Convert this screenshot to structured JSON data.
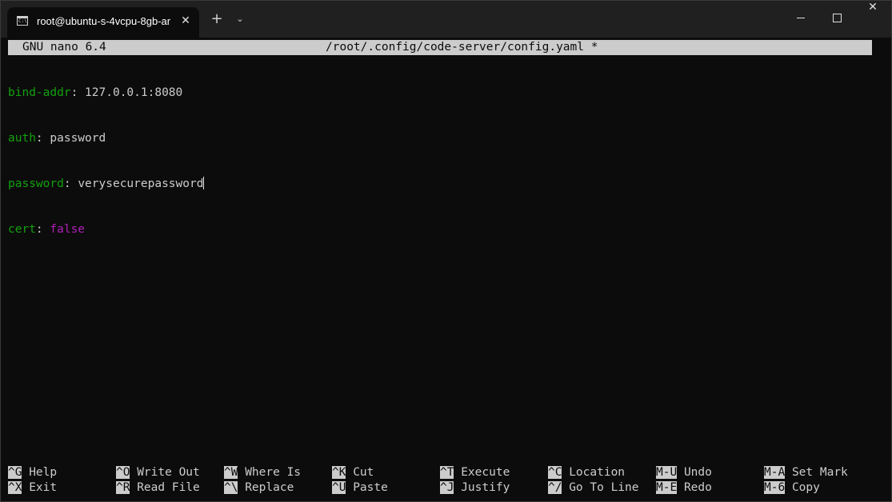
{
  "window": {
    "tab_title": "root@ubuntu-s-4vcpu-8gb-ar",
    "tab_icon_text": "C:\\",
    "new_tab": "+",
    "tab_dropdown": "⌄",
    "close_tab": "✕",
    "close_window": "✕"
  },
  "nano": {
    "version": "GNU nano 6.4",
    "file_path": "/root/.config/code-server/config.yaml *"
  },
  "file_lines": [
    {
      "key": "bind-addr",
      "sep": ": ",
      "value": "127.0.0.1:8080"
    },
    {
      "key": "auth",
      "sep": ": ",
      "value": "password"
    },
    {
      "key": "password",
      "sep": ": ",
      "value": "verysecurepassword"
    },
    {
      "key": "cert",
      "sep": ": ",
      "value": "false"
    }
  ],
  "shortcuts": [
    [
      {
        "key": "^G",
        "label": "Help"
      },
      {
        "key": "^O",
        "label": "Write Out"
      },
      {
        "key": "^W",
        "label": "Where Is"
      },
      {
        "key": "^K",
        "label": "Cut"
      },
      {
        "key": "^T",
        "label": "Execute"
      },
      {
        "key": "^C",
        "label": "Location"
      },
      {
        "key": "M-U",
        "label": "Undo"
      },
      {
        "key": "M-A",
        "label": "Set Mark"
      }
    ],
    [
      {
        "key": "^X",
        "label": "Exit"
      },
      {
        "key": "^R",
        "label": "Read File"
      },
      {
        "key": "^\\",
        "label": "Replace"
      },
      {
        "key": "^U",
        "label": "Paste"
      },
      {
        "key": "^J",
        "label": "Justify"
      },
      {
        "key": "^/",
        "label": "Go To Line"
      },
      {
        "key": "M-E",
        "label": "Redo"
      },
      {
        "key": "M-6",
        "label": "Copy"
      }
    ]
  ],
  "colors": {
    "background": "#0c0c0c",
    "foreground": "#cccccc",
    "yaml_key": "#13a10e",
    "yaml_bool": "#b01fb7"
  }
}
